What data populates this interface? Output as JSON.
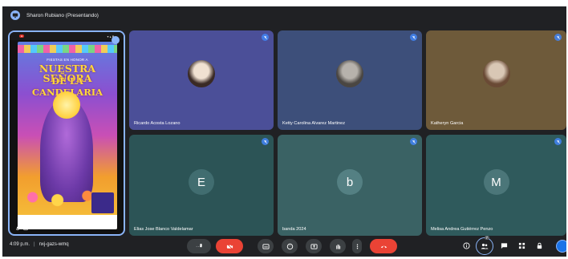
{
  "topbar": {
    "presenting_label": "Sharon Rubiano (Presentando)"
  },
  "presentation": {
    "presenter_name": "Sharon Rubiano",
    "poster": {
      "line1": "FIESTAS EN HONOR A",
      "line2": "NUESTRA SEÑORA",
      "line3": "DE LA CANDELARIA"
    }
  },
  "participants": [
    {
      "name": "Ricardo Acosta Lozano",
      "avatar_type": "photo",
      "bg": "#4b4f98",
      "avatar_colors": [
        "#f1e1d2",
        "#3a2a25"
      ]
    },
    {
      "name": "Ketty Carolina Alvarez Martinez",
      "avatar_type": "photo",
      "bg": "#3d4f7a",
      "avatar_colors": [
        "#b7b2ac",
        "#4a4642"
      ]
    },
    {
      "name": "Katheryn Garcia",
      "avatar_type": "photo",
      "bg": "#6e5a3a",
      "avatar_colors": [
        "#d9c7b5",
        "#6a4a35"
      ]
    },
    {
      "name": "Elias Jose Blanco Valdelamar",
      "avatar_type": "letter",
      "letter": "E",
      "bg": "#2c5456",
      "avatar_bg": "#416d70"
    },
    {
      "name": "banda 2024",
      "avatar_type": "letter",
      "letter": "b",
      "bg": "#3a6264",
      "avatar_bg": "#548083"
    },
    {
      "name": "Melisa Andrea Gutiérrez Penzo",
      "avatar_type": "letter",
      "letter": "M",
      "bg": "#2f5a5c",
      "avatar_bg": "#4b7679"
    }
  ],
  "toolbar": {
    "time": "4:09 p.m.",
    "separator": "|",
    "meeting_code": "nxj-gazs-wmq",
    "participant_count": "7"
  },
  "colors": {
    "meet_bg": "#202124",
    "accent": "#8ab4f8",
    "end_call": "#ea4335",
    "button_bg": "#3c4043"
  }
}
